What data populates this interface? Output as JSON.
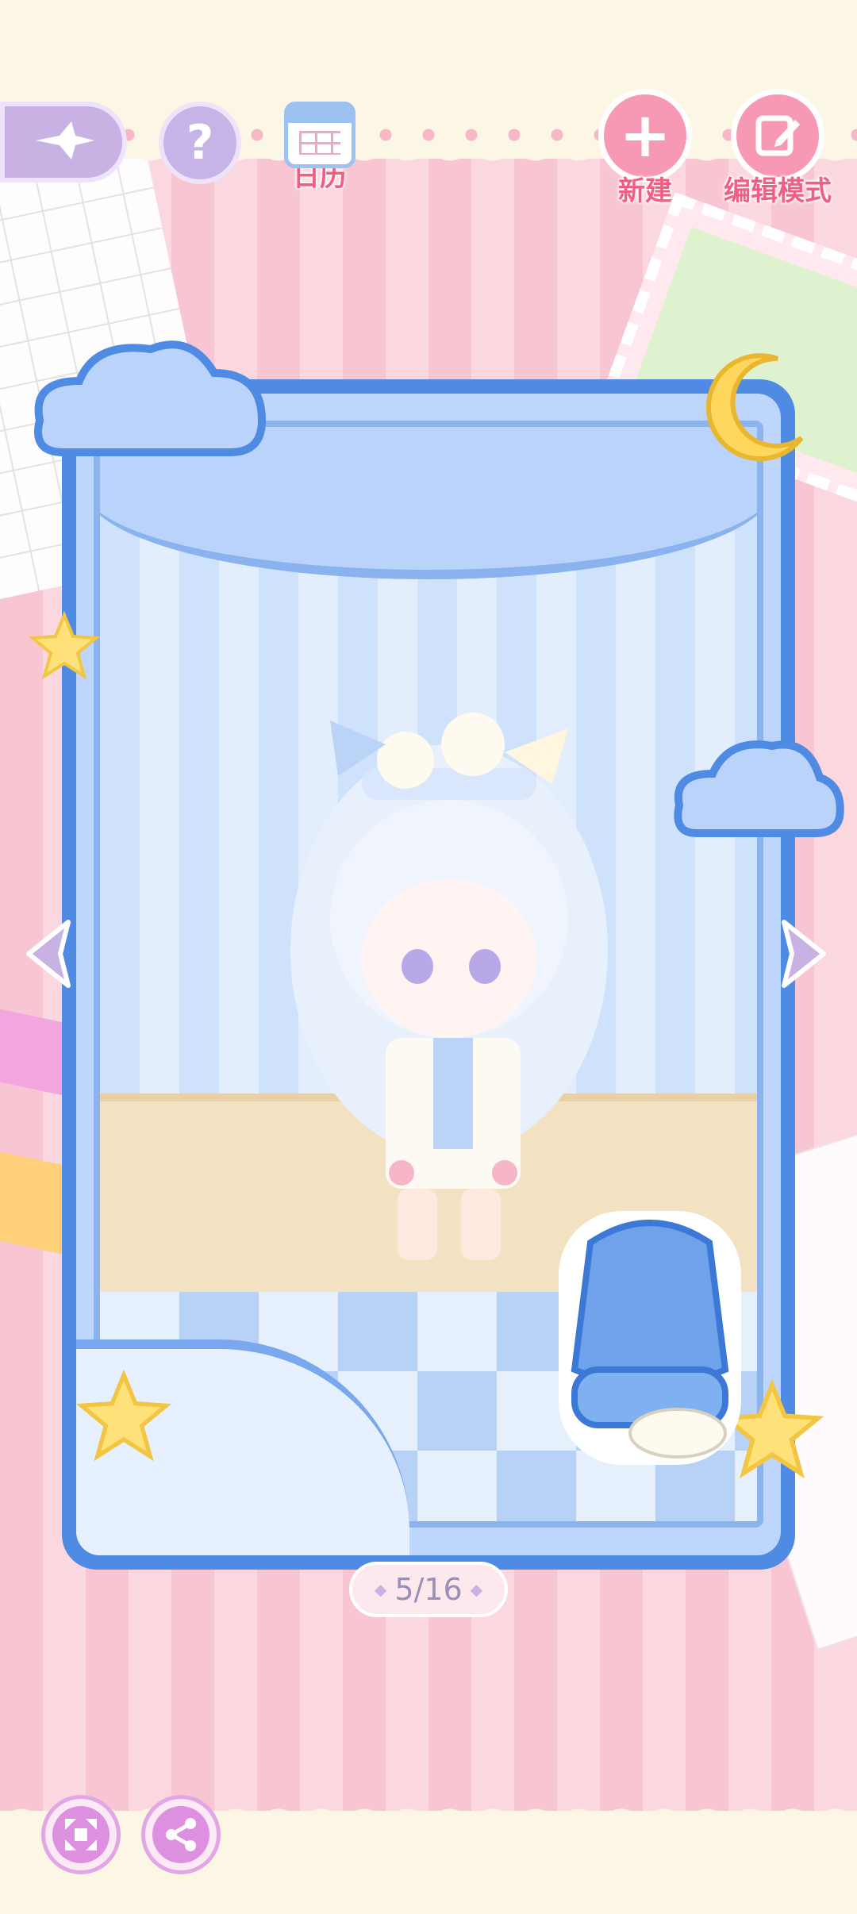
{
  "toolbar": {
    "back_icon": "back-sparkle-icon",
    "help_icon": "question-icon",
    "help_glyph": "?",
    "calendar": {
      "label": "日历",
      "icon": "calendar-icon"
    },
    "new": {
      "label": "新建",
      "icon": "plus-icon",
      "glyph": "+"
    },
    "edit_mode": {
      "label": "编辑模式",
      "icon": "edit-icon"
    }
  },
  "card": {
    "page_indicator": "5/16"
  },
  "bottom_bar": {
    "fullscreen_icon": "expand-icon",
    "share_icon": "share-icon"
  },
  "colors": {
    "accent_pink": "#ef5f83",
    "card_blue": "#4f8be3",
    "lavender": "#c7b2e3"
  }
}
